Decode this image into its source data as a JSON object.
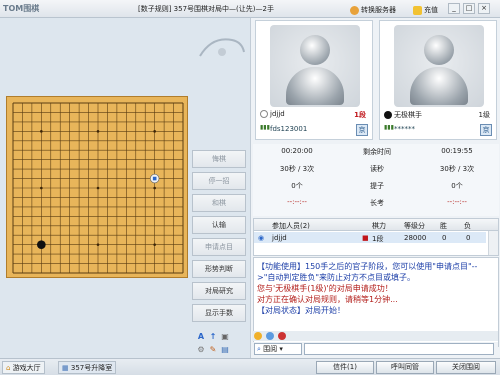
{
  "titlebar": {
    "logo": "TOM围棋",
    "title": "[数子规则] 357号围棋对局中—(让先)—2手",
    "switch_server": "转换服务器",
    "recharge": "充值",
    "minimize": "_",
    "maximize": "□",
    "close": "×"
  },
  "side_buttons": {
    "retract": "悔棋",
    "pause": "停一招",
    "draw": "和棋",
    "resign": "认输",
    "count": "申请点目",
    "judge": "形势判断",
    "research": "对局研究",
    "show_moves": "显示手数"
  },
  "board": {
    "size": 19,
    "stones": [
      {
        "color": "white",
        "col": 15,
        "row": 8
      },
      {
        "color": "black",
        "col": 3,
        "row": 15
      }
    ]
  },
  "players": {
    "left": {
      "name": "jdjjd",
      "rank": "1段",
      "id": "fds123001",
      "region": "京",
      "rank_color": "#c0151a"
    },
    "right": {
      "name": "无极棋手",
      "rank": "1级",
      "id": "******",
      "region": "京"
    }
  },
  "timer": {
    "left_time": "00:20:00",
    "right_time": "00:19:55",
    "remaining_label": "剩余时间",
    "left_byo": "30秒 / 3次",
    "byo_label": "读秒",
    "right_byo": "30秒 / 3次",
    "left_captured": "0个",
    "captured_label": "提子",
    "right_captured": "0个",
    "left_long": "--:--:--",
    "long_label": "长考",
    "right_long": "--:--:--"
  },
  "participants": {
    "headers": [
      "参加人员(2)",
      "棋力",
      "等级分",
      "胜",
      "负"
    ],
    "rows": [
      {
        "name": "jdjjd",
        "rank": "1段",
        "score": "28000",
        "win": "0",
        "loss": "0"
      }
    ]
  },
  "chat": {
    "line1": "【功能使用】150手之后的官子阶段，您可以使用\"申请点目\"-->\"自动判定胜负\"来防止对方不点目或填子。",
    "line2": "您与'无极棋手(1级)'的对局申请成功！",
    "line3": "对方正在确认对局规则，请稍等1分钟...",
    "line4": "【对局状态】对局开始！",
    "mode": "围阅"
  },
  "statusbar": {
    "tab_lobby": "游戏大厅",
    "tab_room": "357号升降室",
    "mail": "信件(1)",
    "friends": "呼叫同管",
    "close_game": "关闭围阅"
  }
}
